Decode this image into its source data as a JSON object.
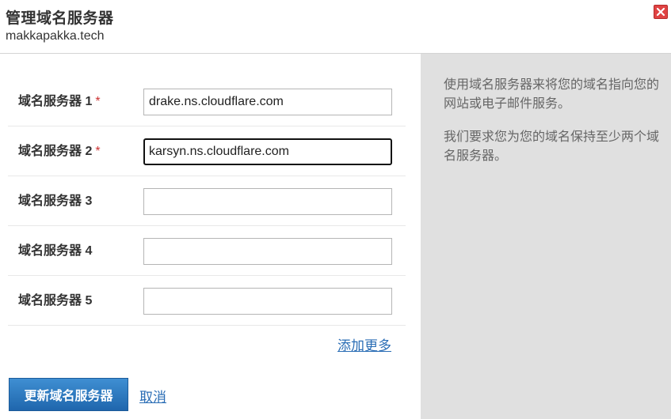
{
  "dialog": {
    "title": "管理域名服务器",
    "domain": "makkapakka.tech"
  },
  "nameservers": [
    {
      "label": "域名服务器 1",
      "required": "*",
      "value": "drake.ns.cloudflare.com"
    },
    {
      "label": "域名服务器 2",
      "required": "*",
      "value": "karsyn.ns.cloudflare.com"
    },
    {
      "label": "域名服务器 3",
      "required": "",
      "value": ""
    },
    {
      "label": "域名服务器 4",
      "required": "",
      "value": ""
    },
    {
      "label": "域名服务器 5",
      "required": "",
      "value": ""
    }
  ],
  "actions": {
    "add_more": "添加更多",
    "update": "更新域名服务器",
    "cancel": "取消"
  },
  "help": {
    "paragraph1": "使用域名服务器来将您的域名指向您的网站或电子邮件服务。",
    "paragraph2": "我们要求您为您的域名保持至少两个域名服务器。"
  },
  "icons": {
    "close": "close-icon"
  },
  "colors": {
    "accent": "#2a6db5",
    "primary_button": "#1f66ad",
    "required": "#cc3333",
    "close": "#e04343",
    "side_panel": "#e0e0e0"
  }
}
